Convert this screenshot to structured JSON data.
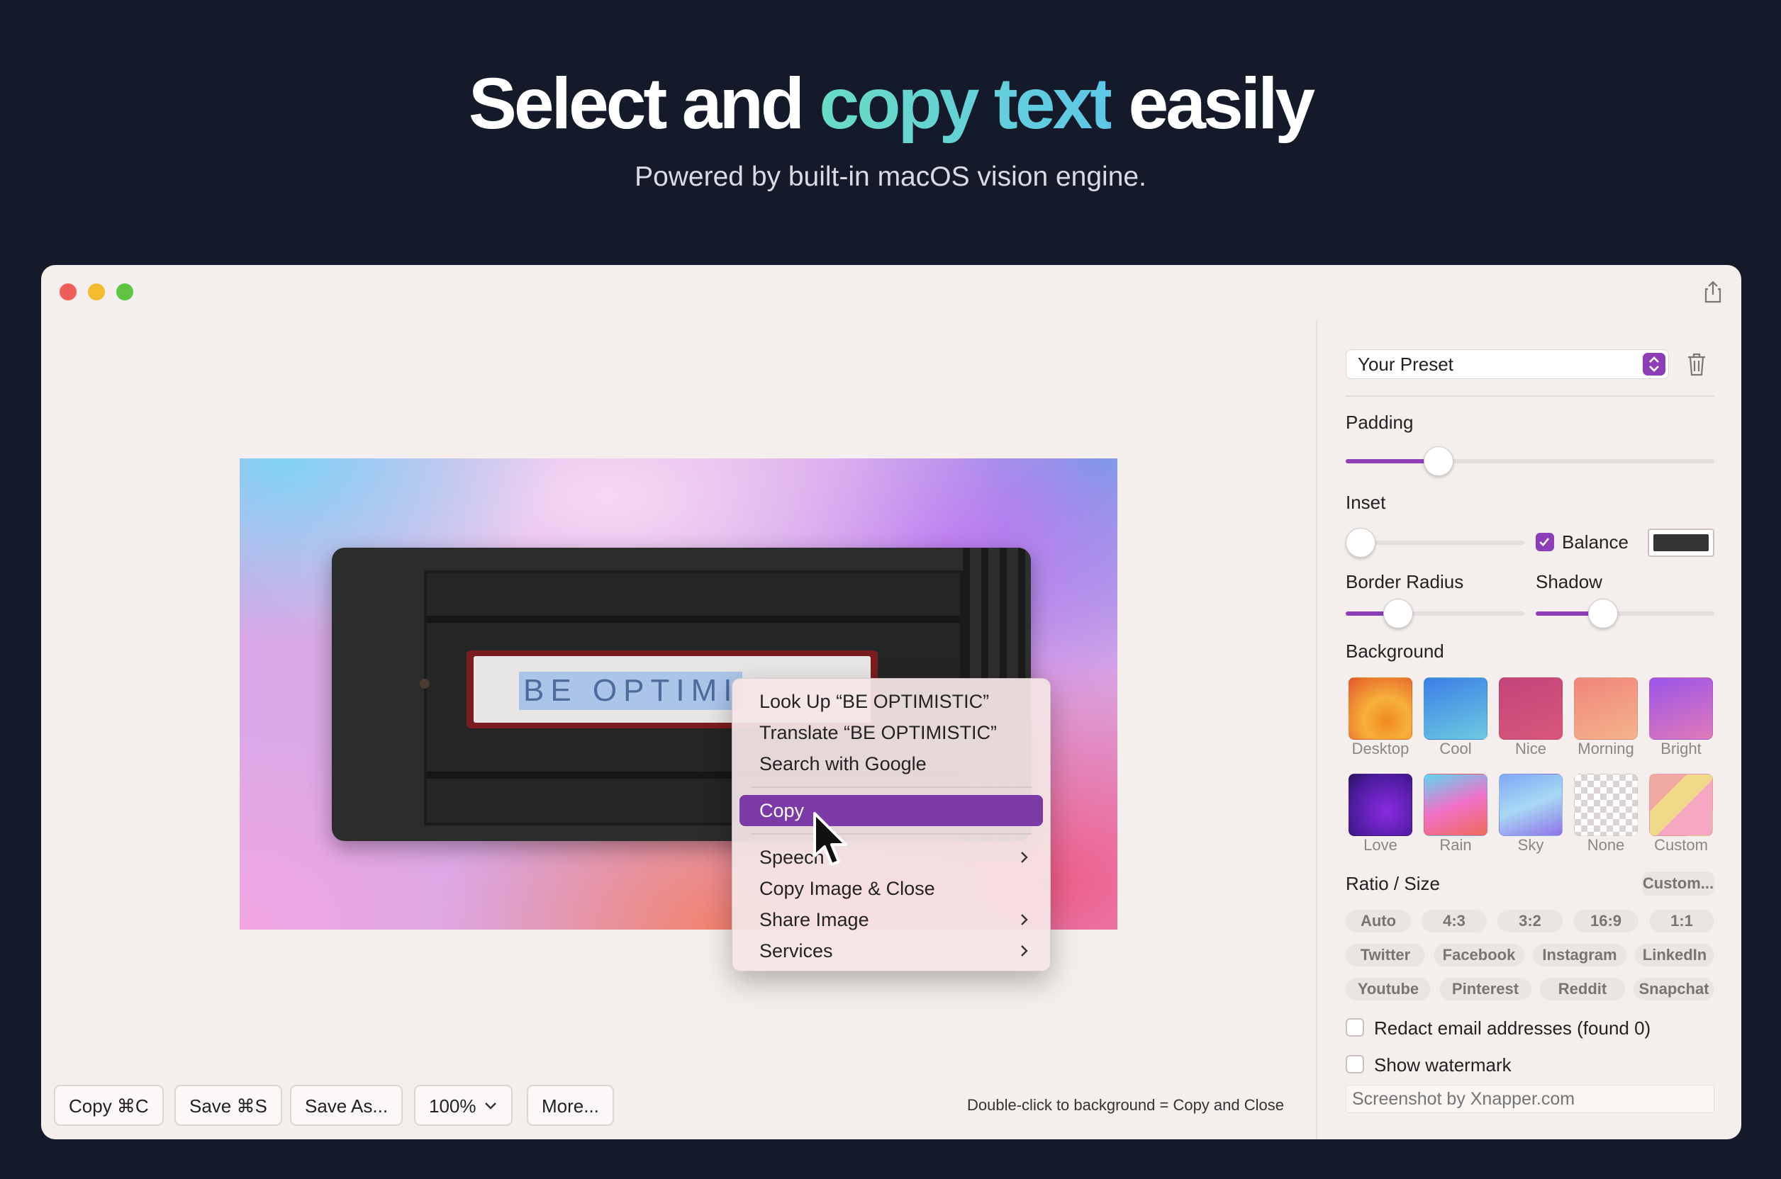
{
  "hero": {
    "title_part1": "Select and ",
    "title_accent": "copy text",
    "title_part2": " easily",
    "subtitle": "Powered by built-in macOS vision engine."
  },
  "canvas": {
    "plate_text": "BE OPTIMI"
  },
  "context_menu": {
    "items": [
      {
        "label": "Look Up “BE OPTIMISTIC”"
      },
      {
        "label": "Translate “BE OPTIMISTIC”"
      },
      {
        "label": "Search with Google"
      },
      {
        "label": "Copy",
        "active": true
      },
      {
        "label": "Speech",
        "submenu": true
      },
      {
        "label": "Copy Image & Close"
      },
      {
        "label": "Share Image",
        "submenu": true
      },
      {
        "label": "Services",
        "submenu": true
      }
    ]
  },
  "toolbar": {
    "copy": "Copy ⌘C",
    "save": "Save ⌘S",
    "save_as": "Save As...",
    "zoom": "100%",
    "more": "More...",
    "hint": "Double-click to background = Copy and Close"
  },
  "side": {
    "preset": "Your Preset",
    "padding_label": "Padding",
    "padding_value": 0.23,
    "inset_label": "Inset",
    "inset_value": 0.0,
    "balance_label": "Balance",
    "balance_checked": true,
    "balance_color": "#333333",
    "border_radius_label": "Border Radius",
    "border_radius_value": 0.25,
    "shadow_label": "Shadow",
    "shadow_value": 0.35,
    "background_label": "Background",
    "backgrounds": [
      {
        "name": "Desktop"
      },
      {
        "name": "Cool"
      },
      {
        "name": "Nice"
      },
      {
        "name": "Morning"
      },
      {
        "name": "Bright"
      },
      {
        "name": "Love"
      },
      {
        "name": "Rain"
      },
      {
        "name": "Sky"
      },
      {
        "name": "None"
      },
      {
        "name": "Custom"
      }
    ],
    "ratio_label": "Ratio / Size",
    "custom_button": "Custom...",
    "ratios": [
      "Auto",
      "4:3",
      "3:2",
      "16:9",
      "1:1"
    ],
    "platforms_row1": [
      "Twitter",
      "Facebook",
      "Instagram",
      "LinkedIn"
    ],
    "platforms_row2": [
      "Youtube",
      "Pinterest",
      "Reddit",
      "Snapchat"
    ],
    "redact_label": "Redact email addresses (found 0)",
    "watermark_label": "Show watermark",
    "watermark_placeholder": "Screenshot by Xnapper.com"
  },
  "colors": {
    "accent": "#8c3db7",
    "menu_highlight": "#7b3aa5",
    "page_bg": "#151a2b",
    "window_bg": "#f4efec"
  }
}
